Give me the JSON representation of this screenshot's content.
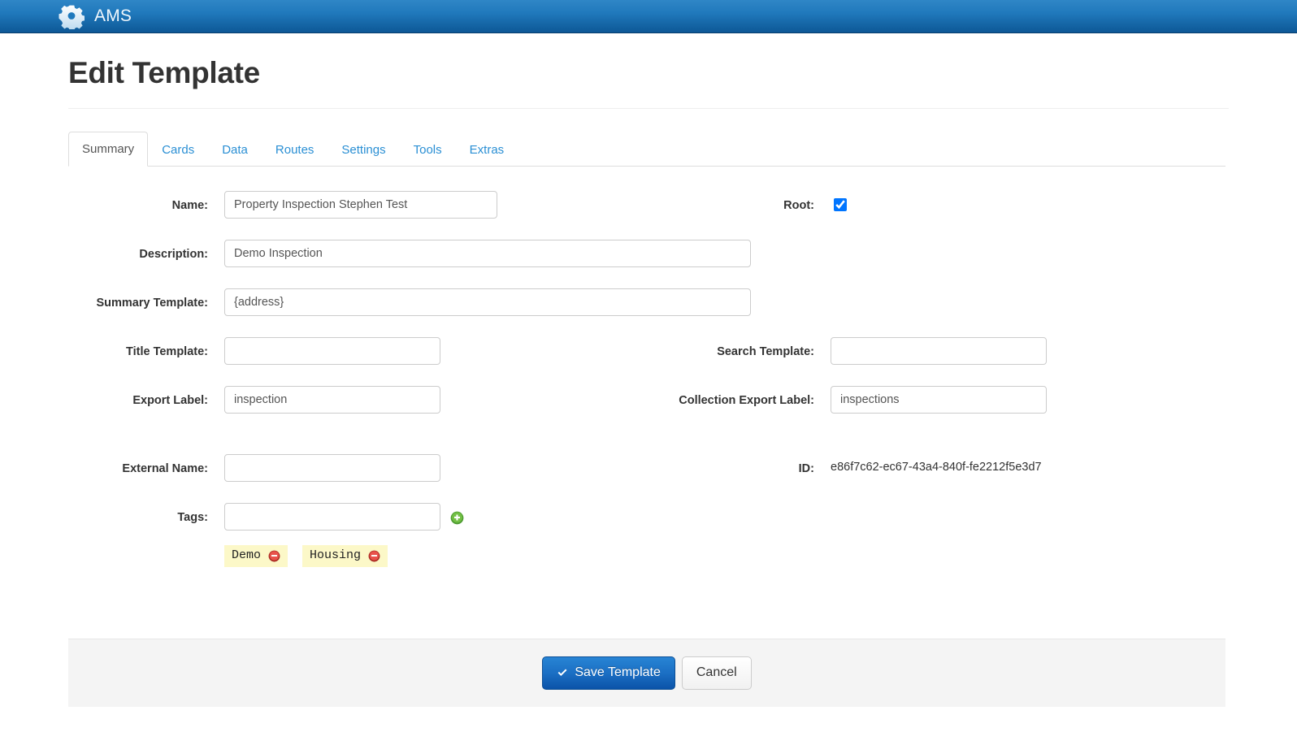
{
  "navbar": {
    "brand_label": "AMS",
    "brand_icon": "gear-icon",
    "gradient_top": "#2f86c6",
    "gradient_bottom": "#0d5896"
  },
  "page": {
    "title": "Edit Template"
  },
  "tabs": [
    {
      "label": "Summary",
      "active": true
    },
    {
      "label": "Cards",
      "active": false
    },
    {
      "label": "Data",
      "active": false
    },
    {
      "label": "Routes",
      "active": false
    },
    {
      "label": "Settings",
      "active": false
    },
    {
      "label": "Tools",
      "active": false
    },
    {
      "label": "Extras",
      "active": false
    }
  ],
  "form": {
    "name": {
      "label": "Name:",
      "value": "Property Inspection Stephen Test",
      "placeholder": ""
    },
    "root": {
      "label": "Root:",
      "checked": true
    },
    "description": {
      "label": "Description:",
      "value": "Demo Inspection",
      "placeholder": ""
    },
    "summary_template": {
      "label": "Summary Template:",
      "value": "{address}",
      "placeholder": ""
    },
    "title_template": {
      "label": "Title Template:",
      "value": "",
      "placeholder": ""
    },
    "search_template": {
      "label": "Search Template:",
      "value": "",
      "placeholder": ""
    },
    "export_label": {
      "label": "Export Label:",
      "value": "inspection",
      "placeholder": ""
    },
    "collection_export_label": {
      "label": "Collection Export Label:",
      "value": "inspections",
      "placeholder": ""
    },
    "external_name": {
      "label": "External Name:",
      "value": "",
      "placeholder": ""
    },
    "id": {
      "label": "ID:",
      "value": "e86f7c62-ec67-43a4-840f-fe2212f5e3d7"
    },
    "tags": {
      "label": "Tags:",
      "input_value": "",
      "placeholder": "",
      "add_icon": "plus-circle-icon",
      "chips": [
        {
          "label": "Demo",
          "remove_icon": "minus-circle-icon"
        },
        {
          "label": "Housing",
          "remove_icon": "minus-circle-icon"
        }
      ]
    }
  },
  "footer": {
    "save_label": "Save Template",
    "save_icon": "check-icon",
    "cancel_label": "Cancel"
  },
  "colors": {
    "brand_blue": "#1b6fc4",
    "link_blue": "#2a8fd4",
    "tag_bg": "#fcf8c8",
    "footer_bg": "#f4f4f4",
    "remove_red": "#d9534f",
    "add_green": "#5cb85c"
  }
}
